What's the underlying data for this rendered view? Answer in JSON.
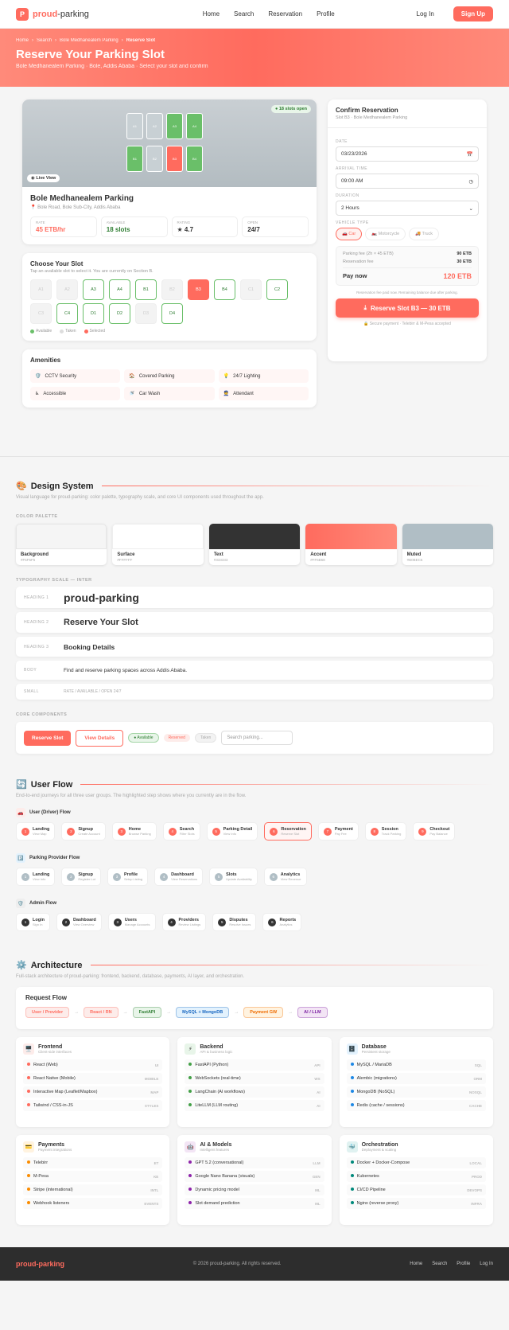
{
  "nav": {
    "logo_letter": "P",
    "logo_accent": "proud",
    "logo_rest": "-parking",
    "links": [
      "Home",
      "Search",
      "Reservation",
      "Profile"
    ],
    "login": "Log In",
    "signup": "Sign Up"
  },
  "hero": {
    "breadcrumb": [
      "Home",
      "Search",
      "Bole Medhanealem Parking",
      "Reserve Slot"
    ],
    "title": "Reserve Your Parking Slot",
    "subtitle": "Bole Medhanealem Parking · Bole, Addis Ababa · Select your slot and confirm"
  },
  "lot": {
    "open_badge": "18 slots open",
    "live": "Live View",
    "mini_slots": [
      "A1",
      "A2",
      "A3",
      "A4",
      "B1",
      "B2",
      "B3",
      "B4"
    ],
    "name": "Bole Medhanealem Parking",
    "address": "Bole Road, Bole Sub-City, Addis Ababa",
    "stats": [
      {
        "k": "RATE",
        "v": "45 ETB/hr"
      },
      {
        "k": "AVAILABLE",
        "v": "18 slots"
      },
      {
        "k": "RATING",
        "v": "★ 4.7"
      },
      {
        "k": "OPEN",
        "v": "24/7"
      }
    ]
  },
  "slots": {
    "title": "Choose Your Slot",
    "subtitle": "Tap an available slot to select it. You are currently on Section B.",
    "items": [
      {
        "id": "A1",
        "s": "tk"
      },
      {
        "id": "A2",
        "s": "tk"
      },
      {
        "id": "A3",
        "s": "av"
      },
      {
        "id": "A4",
        "s": "av"
      },
      {
        "id": "B1",
        "s": "av"
      },
      {
        "id": "B2",
        "s": "tk"
      },
      {
        "id": "B3",
        "s": "sel"
      },
      {
        "id": "B4",
        "s": "av"
      },
      {
        "id": "C1",
        "s": "tk"
      },
      {
        "id": "C2",
        "s": "av"
      },
      {
        "id": "C3",
        "s": "tk"
      },
      {
        "id": "C4",
        "s": "av"
      },
      {
        "id": "D1",
        "s": "av"
      },
      {
        "id": "D2",
        "s": "av"
      },
      {
        "id": "D3",
        "s": "tk"
      },
      {
        "id": "D4",
        "s": "av"
      }
    ],
    "legend": [
      "Available",
      "Taken",
      "Selected"
    ]
  },
  "amenities": {
    "title": "Amenities",
    "items": [
      {
        "icon": "🛡️",
        "label": "CCTV Security"
      },
      {
        "icon": "🏠",
        "label": "Covered Parking"
      },
      {
        "icon": "💡",
        "label": "24/7 Lighting"
      },
      {
        "icon": "♿",
        "label": "Accessible"
      },
      {
        "icon": "🚿",
        "label": "Car Wash"
      },
      {
        "icon": "👮",
        "label": "Attendant"
      }
    ]
  },
  "confirm": {
    "title": "Confirm Reservation",
    "subtitle": "Slot B3 · Bole Medhanealem Parking",
    "date_label": "DATE",
    "date": "03/23/2026",
    "time_label": "ARRIVAL TIME",
    "time": "09:00 AM",
    "dur_label": "DURATION",
    "duration": "2 Hours",
    "vt_label": "VEHICLE TYPE",
    "vehicles": [
      "🚗 Car",
      "🏍️ Motorcycle",
      "🚚 Truck"
    ],
    "fee_label": "Parking fee (2h × 45 ETB)",
    "fee": "90 ETB",
    "res_label": "Reservation fee",
    "res": "30 ETB",
    "pay_label": "Pay now",
    "pay": "120 ETB",
    "note": "Reservation fee paid now. Remaining balance due after parking.",
    "button": "Reserve Slot B3 — 30 ETB",
    "secure": "Secure payment · Telebirr & M-Pesa accepted"
  },
  "design": {
    "title": "Design System",
    "icon": "🎨",
    "desc": "Visual language for proud-parking: color palette, typography scale, and core UI components used throughout the app.",
    "palette_label": "COLOR PALETTE",
    "palette": [
      {
        "name": "Background",
        "hex": "#F5F5F5",
        "color": "#f5f5f5"
      },
      {
        "name": "Surface",
        "hex": "#FFFFFF",
        "color": "#ffffff"
      },
      {
        "name": "Text",
        "hex": "#333333",
        "color": "#333333"
      },
      {
        "name": "Accent",
        "hex": "#FF6B5E",
        "color": "#ff6b5e"
      },
      {
        "name": "Muted",
        "hex": "#B0BEC5",
        "color": "#b0bec5"
      }
    ],
    "type_label": "TYPOGRAPHY SCALE — INTER",
    "type": [
      {
        "l": "HEADING 1",
        "t": "proud-parking"
      },
      {
        "l": "HEADING 2",
        "t": "Reserve Your Slot"
      },
      {
        "l": "HEADING 3",
        "t": "Booking Details"
      },
      {
        "l": "BODY",
        "t": "Find and reserve parking spaces across Addis Ababa."
      },
      {
        "l": "SMALL",
        "t": "RATE / AVAILABLE / OPEN 24/7"
      }
    ],
    "comp_label": "CORE COMPONENTS",
    "btn_primary": "Reserve Slot",
    "btn_secondary": "View Details",
    "pill_av": "● Available",
    "pill_res": "Reserved",
    "pill_tk": "Taken",
    "search_ph": "Search parking..."
  },
  "flow": {
    "title": "User Flow",
    "icon": "🔄",
    "desc": "End-to-end journeys for all three user groups. The highlighted step shows where you currently are in the flow.",
    "driver": {
      "title": "User (Driver) Flow",
      "icon": "🚗",
      "steps": [
        {
          "t": "Landing",
          "s": "View Map"
        },
        {
          "t": "Signup",
          "s": "Create Account"
        },
        {
          "t": "Home",
          "s": "Browse Parking"
        },
        {
          "t": "Search",
          "s": "Filter Slots"
        },
        {
          "t": "Parking Detail",
          "s": "View Info"
        },
        {
          "t": "Reservation",
          "s": "Reserve Slot"
        },
        {
          "t": "Payment",
          "s": "Pay Fee"
        },
        {
          "t": "Session",
          "s": "Track Parking"
        },
        {
          "t": "Checkout",
          "s": "Pay Balance"
        }
      ]
    },
    "provider": {
      "title": "Parking Provider Flow",
      "icon": "🅿️",
      "steps": [
        {
          "t": "Landing",
          "s": "View Info"
        },
        {
          "t": "Signup",
          "s": "Register Lot"
        },
        {
          "t": "Profile",
          "s": "Setup Listing"
        },
        {
          "t": "Dashboard",
          "s": "View Reservations"
        },
        {
          "t": "Slots",
          "s": "Update Availability"
        },
        {
          "t": "Analytics",
          "s": "View Revenue"
        }
      ]
    },
    "admin": {
      "title": "Admin Flow",
      "icon": "🛡️",
      "steps": [
        {
          "t": "Login",
          "s": "Sign In"
        },
        {
          "t": "Dashboard",
          "s": "View Overview"
        },
        {
          "t": "Users",
          "s": "Manage Accounts"
        },
        {
          "t": "Providers",
          "s": "Review Listings"
        },
        {
          "t": "Disputes",
          "s": "Resolve Issues"
        },
        {
          "t": "Reports",
          "s": "Analytics"
        }
      ]
    }
  },
  "arch": {
    "title": "Architecture",
    "icon": "⚙️",
    "desc": "Full-stack architecture of proud-parking: frontend, backend, database, payments, AI layer, and orchestration.",
    "rf_title": "Request Flow",
    "rf": [
      {
        "t": "User / Provider",
        "bg": "#fdecea",
        "c": "#ff6b5e"
      },
      {
        "t": "React / RN",
        "bg": "#fdecea",
        "c": "#ff6b5e"
      },
      {
        "t": "FastAPI",
        "bg": "#e8f5e9",
        "c": "#2e7d32"
      },
      {
        "t": "MySQL + MongoDB",
        "bg": "#e3f2fd",
        "c": "#1565c0"
      },
      {
        "t": "Payment GW",
        "bg": "#fff3e0",
        "c": "#ef6c00"
      },
      {
        "t": "AI / LLM",
        "bg": "#f3e5f5",
        "c": "#7b1fa2"
      }
    ],
    "cards": [
      {
        "icon": "🖥️",
        "ibg": "#fdecea",
        "t": "Frontend",
        "s": "Client-side interfaces",
        "dot": "#ff6b5e",
        "items": [
          {
            "n": "React (Web)",
            "tag": "UI"
          },
          {
            "n": "React Native (Mobile)",
            "tag": "MOBILE"
          },
          {
            "n": "Interactive Map (Leaflet/Mapbox)",
            "tag": "MAP"
          },
          {
            "n": "Tailwind / CSS-in-JS",
            "tag": "STYLES"
          }
        ]
      },
      {
        "icon": "⚡",
        "ibg": "#e8f5e9",
        "t": "Backend",
        "s": "API & business logic",
        "dot": "#43a047",
        "items": [
          {
            "n": "FastAPI (Python)",
            "tag": "API"
          },
          {
            "n": "WebSockets (real-time)",
            "tag": "WS"
          },
          {
            "n": "LangChain (AI workflows)",
            "tag": "AI"
          },
          {
            "n": "LiteLLM (LLM routing)",
            "tag": "AI"
          }
        ]
      },
      {
        "icon": "🗄️",
        "ibg": "#e3f2fd",
        "t": "Database",
        "s": "Persistent storage",
        "dot": "#1e88e5",
        "items": [
          {
            "n": "MySQL / MariaDB",
            "tag": "SQL"
          },
          {
            "n": "Alembic (migrations)",
            "tag": "ORM"
          },
          {
            "n": "MongoDB (NoSQL)",
            "tag": "NOSQL"
          },
          {
            "n": "Redis (cache / sessions)",
            "tag": "CACHE"
          }
        ]
      },
      {
        "icon": "💳",
        "ibg": "#fff3e0",
        "t": "Payments",
        "s": "Payment integrations",
        "dot": "#fb8c00",
        "items": [
          {
            "n": "Telebirr",
            "tag": "ET"
          },
          {
            "n": "M-Pesa",
            "tag": "KE"
          },
          {
            "n": "Stripe (international)",
            "tag": "INTL"
          },
          {
            "n": "Webhook listeners",
            "tag": "EVENTS"
          }
        ]
      },
      {
        "icon": "🤖",
        "ibg": "#f3e5f5",
        "t": "AI & Models",
        "s": "Intelligent features",
        "dot": "#8e24aa",
        "items": [
          {
            "n": "GPT 5.2 (conversational)",
            "tag": "LLM"
          },
          {
            "n": "Google Nano Banana (visuals)",
            "tag": "GEN"
          },
          {
            "n": "Dynamic pricing model",
            "tag": "ML"
          },
          {
            "n": "Slot demand prediction",
            "tag": "ML"
          }
        ]
      },
      {
        "icon": "🐳",
        "ibg": "#e0f2f1",
        "t": "Orchestration",
        "s": "Deployment & scaling",
        "dot": "#00897b",
        "items": [
          {
            "n": "Docker + Docker-Compose",
            "tag": "LOCAL"
          },
          {
            "n": "Kubernetes",
            "tag": "PROD"
          },
          {
            "n": "CI/CD Pipeline",
            "tag": "DEVOPS"
          },
          {
            "n": "Nginx (reverse proxy)",
            "tag": "INFRA"
          }
        ]
      }
    ]
  },
  "footer": {
    "logo": "proud-parking",
    "copy": "© 2026 proud-parking. All rights reserved.",
    "links": [
      "Home",
      "Search",
      "Profile",
      "Log In"
    ]
  }
}
